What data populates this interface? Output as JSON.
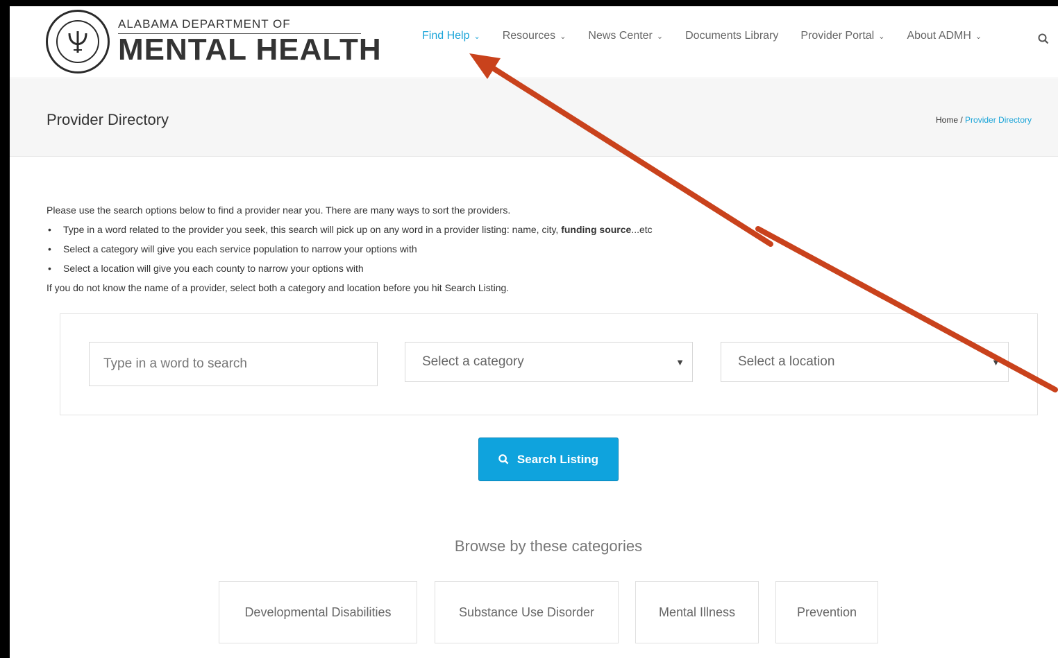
{
  "logo": {
    "line1": "ALABAMA DEPARTMENT OF",
    "line2": "MENTAL HEALTH"
  },
  "nav": {
    "items": [
      {
        "label": "Find Help",
        "dropdown": true,
        "active": true
      },
      {
        "label": "Resources",
        "dropdown": true
      },
      {
        "label": "News Center",
        "dropdown": true
      },
      {
        "label": "Documents Library",
        "dropdown": false
      },
      {
        "label": "Provider Portal",
        "dropdown": true
      },
      {
        "label": "About ADMH",
        "dropdown": true
      }
    ],
    "search_icon": "search-icon"
  },
  "titlebar": {
    "title": "Provider Directory",
    "breadcrumb_home": "Home",
    "breadcrumb_sep": " / ",
    "breadcrumb_current": "Provider Directory"
  },
  "intro": {
    "lead": "Please use the search options below to find a provider near you. There are many ways to sort the providers.",
    "bullet1_pre": "Type in a word related to the provider you seek, this search will pick up on any word in a provider listing: name, city, ",
    "bullet1_bold": "funding source",
    "bullet1_post": "...etc",
    "bullet2": "Select a category will give you each service population to narrow your options with",
    "bullet3": "Select a location will give you each county to narrow your options with",
    "note": "If you do not know the name of a provider, select both a category and location before you hit Search Listing."
  },
  "search": {
    "word_placeholder": "Type in a word to search",
    "category_value": "Select a category",
    "location_value": "Select a location",
    "button_label": "Search Listing"
  },
  "browse": {
    "title": "Browse by these categories",
    "categories": [
      "Developmental Disabilities",
      "Substance Use Disorder",
      "Mental Illness",
      "Prevention"
    ]
  },
  "colors": {
    "accent": "#1aa4d8",
    "button": "#0fa3dd",
    "annotation_arrow": "#c9421c"
  }
}
